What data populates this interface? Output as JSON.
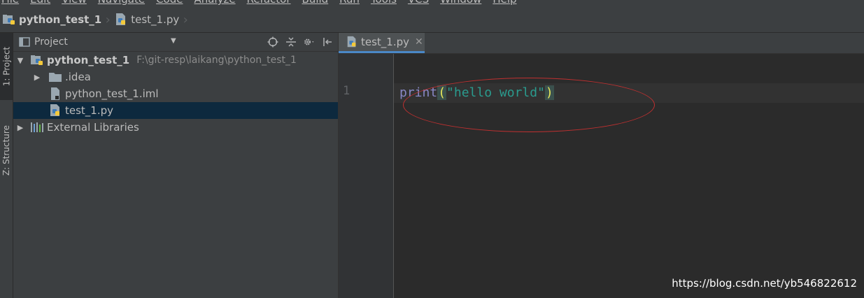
{
  "menubar": {
    "items": [
      "File",
      "Edit",
      "View",
      "Navigate",
      "Code",
      "Analyze",
      "Refactor",
      "Build",
      "Run",
      "Tools",
      "VCS",
      "Window",
      "Help"
    ]
  },
  "navbar": {
    "project": "python_test_1",
    "file": "test_1.py"
  },
  "stripe": {
    "project_tab": "1: Project",
    "structure_tab": "Z: Structure"
  },
  "project_panel": {
    "title": "Project",
    "tree": {
      "root_name": "python_test_1",
      "root_path": "F:\\git-resp\\laikang\\python_test_1",
      "idea": ".idea",
      "iml": "python_test_1.iml",
      "py": "test_1.py",
      "libs": "External Libraries"
    }
  },
  "editor": {
    "tab_label": "test_1.py",
    "line_number": "1",
    "code_fn": "print",
    "code_open": "(",
    "code_str": "\"hello world\"",
    "code_close": ")"
  },
  "watermark": "https://blog.csdn.net/yb546822612",
  "colors": {
    "background": "#2b2b2b",
    "panel": "#3c3f41",
    "selection": "#0d293e",
    "tab_accent": "#4a88c7",
    "annotation_ellipse": "#c03030"
  }
}
